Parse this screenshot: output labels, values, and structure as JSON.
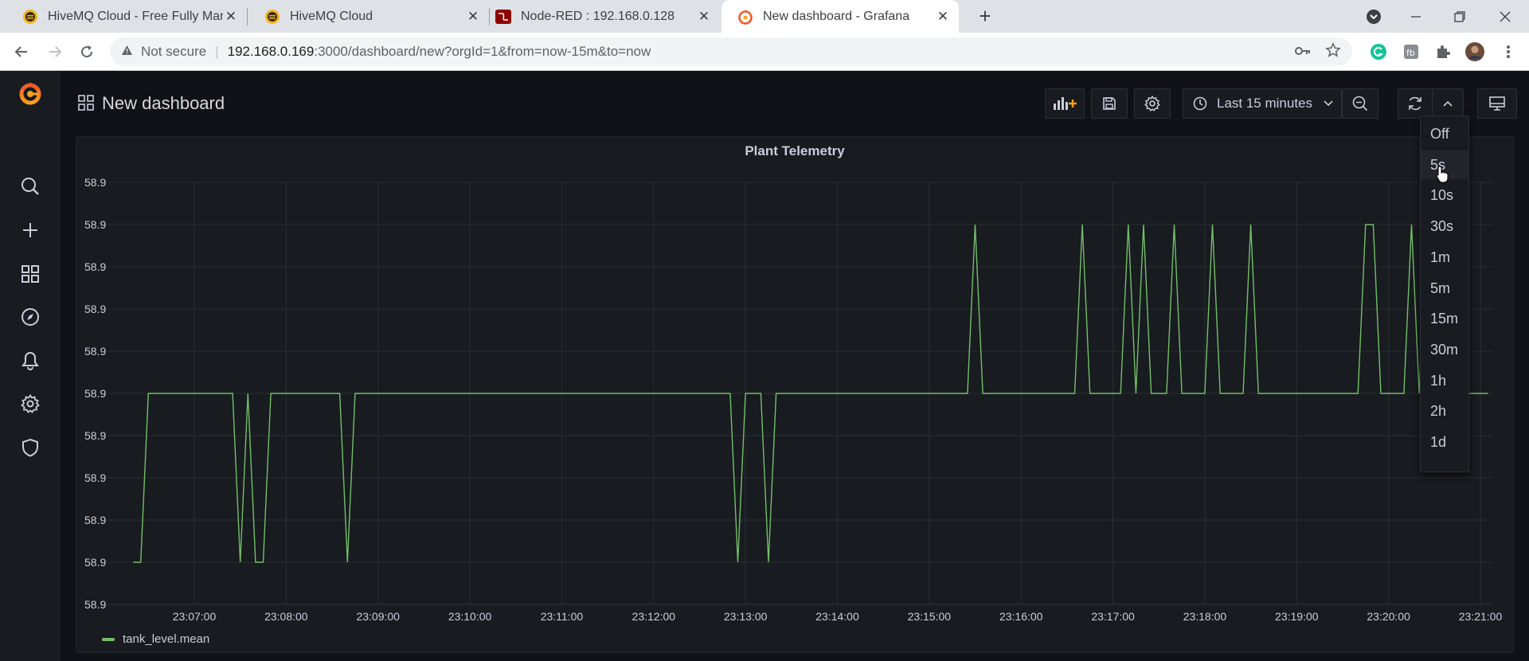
{
  "browser": {
    "tabs": [
      {
        "title": "HiveMQ Cloud - Free Fully Managed",
        "favicon": "hivemq-icon",
        "active": false
      },
      {
        "title": "HiveMQ Cloud",
        "favicon": "hivemq-icon",
        "active": false
      },
      {
        "title": "Node-RED : 192.168.0.128",
        "favicon": "node-red-icon",
        "active": false
      },
      {
        "title": "New dashboard - Grafana",
        "favicon": "grafana-icon",
        "active": true
      }
    ],
    "address": {
      "security": "Not secure",
      "host": "192.168.0.169",
      "path": ":3000/dashboard/new?orgId=1&from=now-15m&to=now"
    }
  },
  "dashboard": {
    "title": "New dashboard",
    "time_range": "Last 15 minutes"
  },
  "panel": {
    "title": "Plant Telemetry"
  },
  "refresh_menu": {
    "options": [
      "Off",
      "5s",
      "10s",
      "30s",
      "1m",
      "5m",
      "15m",
      "30m",
      "1h",
      "2h",
      "1d"
    ],
    "hovered": "5s"
  },
  "colors": {
    "series": "#73bf69",
    "accent": "#f05a28",
    "background": "#111217",
    "panel": "#181b1f"
  },
  "chart_data": {
    "type": "line",
    "title": "Plant Telemetry",
    "ytick_labels": [
      "58.9",
      "58.9",
      "58.9",
      "58.9",
      "58.9",
      "58.9",
      "58.9",
      "58.9",
      "58.9",
      "58.9",
      "58.9"
    ],
    "xtick_labels": [
      "23:07:00",
      "23:08:00",
      "23:09:00",
      "23:10:00",
      "23:11:00",
      "23:12:00",
      "23:13:00",
      "23:14:00",
      "23:15:00",
      "23:16:00",
      "23:17:00",
      "23:18:00",
      "23:19:00",
      "23:20:00",
      "23:21:00"
    ],
    "grid": true,
    "legend": "bottom-left",
    "series": [
      {
        "name": "tank_level.mean",
        "points": [
          [
            "23:06:20",
            1
          ],
          [
            "23:06:25",
            1
          ],
          [
            "23:06:30",
            5
          ],
          [
            "23:07:25",
            5
          ],
          [
            "23:07:30",
            1
          ],
          [
            "23:07:35",
            5
          ],
          [
            "23:07:40",
            1
          ],
          [
            "23:07:45",
            1
          ],
          [
            "23:07:50",
            5
          ],
          [
            "23:08:35",
            5
          ],
          [
            "23:08:40",
            1
          ],
          [
            "23:08:45",
            5
          ],
          [
            "23:12:50",
            5
          ],
          [
            "23:12:55",
            1
          ],
          [
            "23:13:00",
            5
          ],
          [
            "23:13:10",
            5
          ],
          [
            "23:13:15",
            1
          ],
          [
            "23:13:20",
            5
          ],
          [
            "23:15:25",
            5
          ],
          [
            "23:15:30",
            9
          ],
          [
            "23:15:35",
            5
          ],
          [
            "23:16:35",
            5
          ],
          [
            "23:16:40",
            9
          ],
          [
            "23:16:45",
            5
          ],
          [
            "23:17:05",
            5
          ],
          [
            "23:17:10",
            9
          ],
          [
            "23:17:15",
            5
          ],
          [
            "23:17:20",
            9
          ],
          [
            "23:17:25",
            5
          ],
          [
            "23:17:35",
            5
          ],
          [
            "23:17:40",
            9
          ],
          [
            "23:17:45",
            5
          ],
          [
            "23:18:00",
            5
          ],
          [
            "23:18:05",
            9
          ],
          [
            "23:18:10",
            5
          ],
          [
            "23:18:25",
            5
          ],
          [
            "23:18:30",
            9
          ],
          [
            "23:18:35",
            5
          ],
          [
            "23:19:40",
            5
          ],
          [
            "23:19:45",
            9
          ],
          [
            "23:19:50",
            9
          ],
          [
            "23:19:55",
            5
          ],
          [
            "23:20:10",
            5
          ],
          [
            "23:20:15",
            9
          ],
          [
            "23:20:20",
            5
          ],
          [
            "23:20:25",
            9
          ],
          [
            "23:20:30",
            5
          ],
          [
            "23:20:35",
            5
          ],
          [
            "23:20:40",
            9
          ],
          [
            "23:20:45",
            5
          ],
          [
            "23:21:05",
            5
          ]
        ]
      }
    ]
  }
}
